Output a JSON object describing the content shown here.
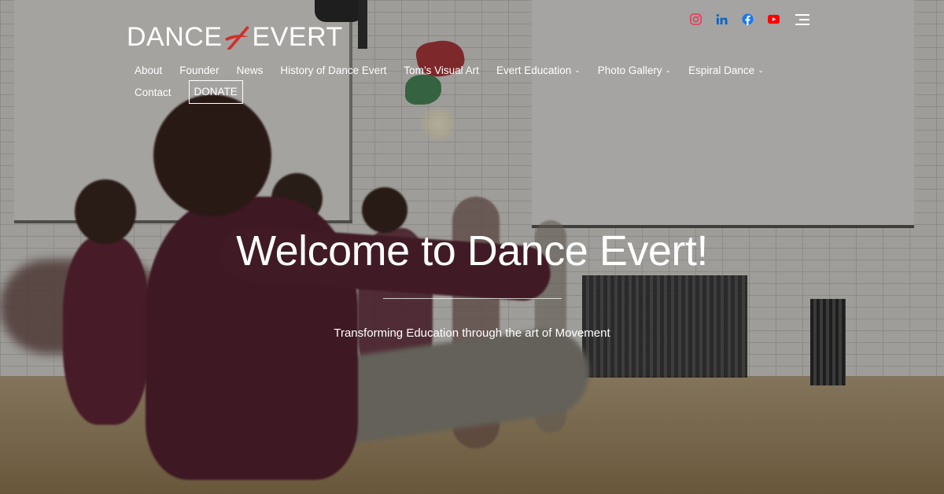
{
  "brand": {
    "logo_left": "DANCE",
    "logo_right": "EVERT",
    "accent_color": "#d0302b"
  },
  "social": [
    {
      "name": "instagram",
      "icon": "instagram-icon",
      "color": "#e4405f"
    },
    {
      "name": "linkedin",
      "icon": "linkedin-icon",
      "color": "#0a66c2"
    },
    {
      "name": "facebook",
      "icon": "facebook-icon",
      "color": "#1877f2"
    },
    {
      "name": "youtube",
      "icon": "youtube-icon",
      "color": "#ff0000"
    }
  ],
  "nav": {
    "items": [
      {
        "label": "About",
        "has_submenu": false
      },
      {
        "label": "Founder",
        "has_submenu": false
      },
      {
        "label": "News",
        "has_submenu": false
      },
      {
        "label": "History of Dance Evert",
        "has_submenu": false
      },
      {
        "label": "Tom’s Visual Art",
        "has_submenu": false
      },
      {
        "label": "Evert Education",
        "has_submenu": true
      },
      {
        "label": "Photo Gallery",
        "has_submenu": true
      },
      {
        "label": "Espiral Dance",
        "has_submenu": true
      }
    ],
    "contact": "Contact",
    "donate": "DONATE",
    "caret": "⌄"
  },
  "hero": {
    "title": "Welcome to Dance Evert!",
    "subtitle": "Transforming Education through the art of Movement"
  }
}
